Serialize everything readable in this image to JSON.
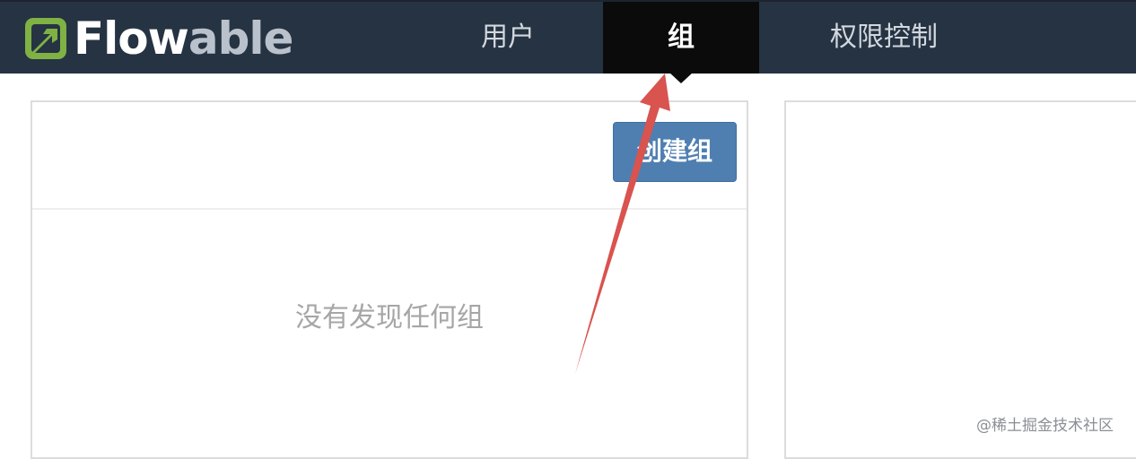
{
  "header": {
    "logo": {
      "text_flow": "Flow",
      "text_able": "able",
      "icon": "flowable-arrow-logo-icon"
    },
    "nav": [
      {
        "label": "用户",
        "active": false
      },
      {
        "label": "组",
        "active": true
      },
      {
        "label": "权限控制",
        "active": false
      }
    ]
  },
  "main": {
    "create_button_label": "创建组",
    "empty_message": "没有发现任何组"
  },
  "annotation": {
    "icon": "red-arrow-icon",
    "color": "#d9534f"
  },
  "watermark": "@稀土掘金技术社区",
  "colors": {
    "header_bg": "#263343",
    "active_tab_bg": "#0b0b0b",
    "button_bg": "#4f7fb1"
  }
}
